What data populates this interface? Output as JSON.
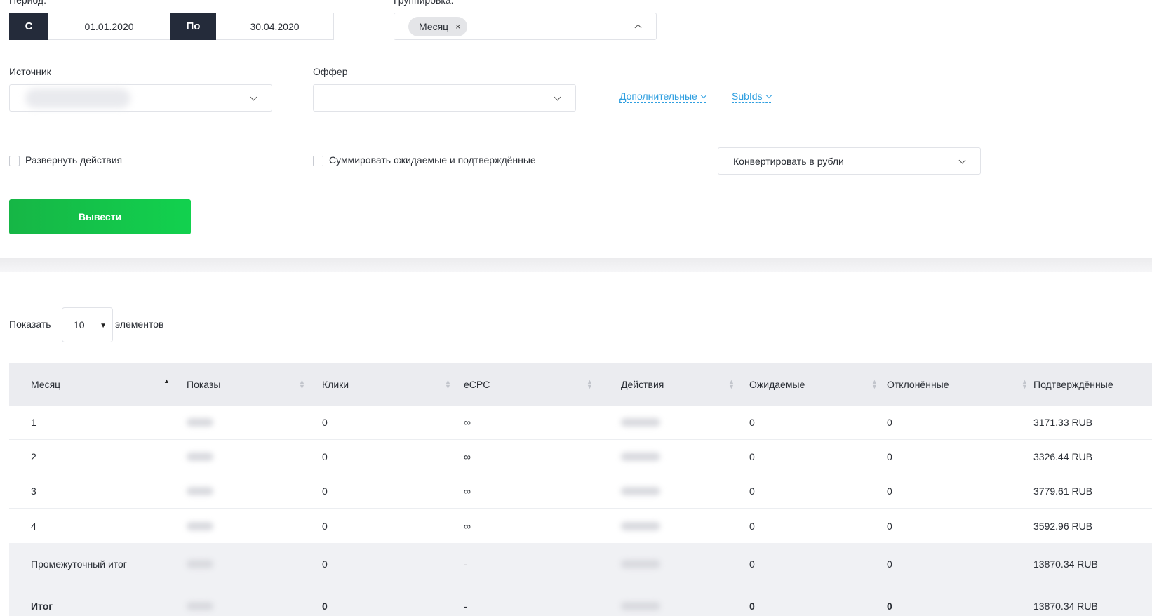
{
  "filters": {
    "period_label": "Период:",
    "from_tag": "С",
    "from_date": "01.01.2020",
    "to_tag": "По",
    "to_date": "30.04.2020",
    "grouping_label": "Группировка:",
    "grouping_chip": "Месяц",
    "chip_remove": "×",
    "source_label": "Источник",
    "offer_label": "Оффер",
    "additional_link": "Дополнительные",
    "subids_link": "SubIds",
    "expand_actions": "Развернуть действия",
    "sum_expected": "Суммировать ожидаемые и подтверждённые",
    "convert_select": "Конвертировать в рубли",
    "submit": "Вывести"
  },
  "pager": {
    "show_label": "Показать",
    "page_size": "10",
    "items_label": "элементов"
  },
  "table": {
    "headers": [
      "Месяц",
      "Показы",
      "Клики",
      "eCPC",
      "Действия",
      "Ожидаемые",
      "Отклонённые",
      "Подтверждённые"
    ],
    "rows": [
      [
        "1",
        "0",
        "∞",
        "0",
        "0",
        "3171.33 RUB"
      ],
      [
        "2",
        "0",
        "∞",
        "0",
        "0",
        "3326.44 RUB"
      ],
      [
        "3",
        "0",
        "∞",
        "0",
        "0",
        "3779.61 RUB"
      ],
      [
        "4",
        "0",
        "∞",
        "0",
        "0",
        "3592.96 RUB"
      ]
    ],
    "subtotal": [
      "Промежуточный итог",
      "0",
      "-",
      "0",
      "0",
      "13870.34 RUB"
    ],
    "total": [
      "Итог",
      "0",
      "-",
      "0",
      "0",
      "13870.34 RUB"
    ]
  }
}
